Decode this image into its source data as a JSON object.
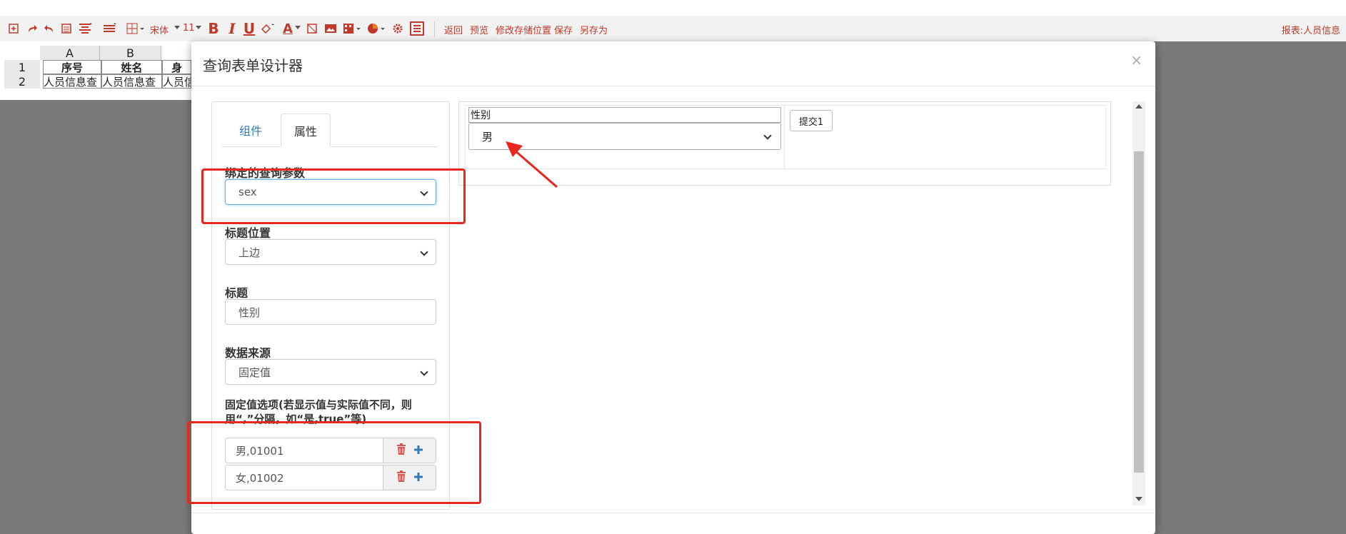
{
  "toolbar": {
    "font_name": "宋体",
    "font_size": "11",
    "bold": "B",
    "italic": "I",
    "underline": "U",
    "font_color": "A",
    "menu": [
      "返回",
      "预览",
      "修改存储位置",
      "保存",
      "另存为"
    ],
    "report_name": "报表:人员信息"
  },
  "sheet": {
    "columns": [
      "A",
      "B"
    ],
    "rows": [
      "1",
      "2"
    ],
    "row1": [
      "序号",
      "姓名",
      "身"
    ],
    "row2": [
      "人员信息查",
      "人员信息查",
      "人员信"
    ]
  },
  "modal": {
    "title": "查询表单设计器",
    "close": "×",
    "tabs": [
      "组件",
      "属性"
    ],
    "fields": {
      "param_label": "绑定的查询参数",
      "param_value": "sex",
      "title_pos_label": "标题位置",
      "title_pos_value": "上边",
      "title_label": "标题",
      "title_value": "性别",
      "source_label": "数据来源",
      "source_value": "固定值",
      "options_note": "固定值选项(若显示值与实际值不同，则用“,”分隔，如“是,true”等)",
      "options": [
        "男,01001",
        "女,01002"
      ]
    },
    "preview": {
      "label": "性别",
      "value": "男",
      "submit": "提交1"
    }
  },
  "colors": {
    "accent": "#c0392b",
    "annotation": "#e8261e",
    "tab_active": "#337ab7",
    "delete": "#d9534f",
    "add": "#337ab7"
  }
}
